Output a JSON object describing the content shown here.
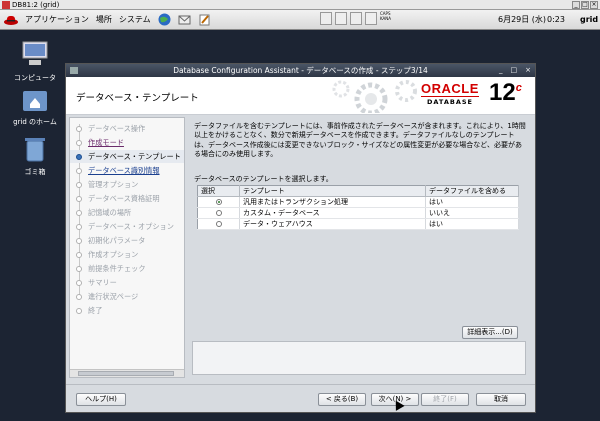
{
  "vnc": {
    "title": "DB81:2 (grid)"
  },
  "panel": {
    "menus": [
      "アプリケーション",
      "場所",
      "システム"
    ],
    "date": "6月29日 (水)",
    "time": "0:23",
    "user": "grid",
    "kbd_line1": "CAPS",
    "kbd_line2": "KANA"
  },
  "desktop": {
    "icons": [
      {
        "label": "コンピュータ"
      },
      {
        "label": "grid のホーム"
      },
      {
        "label": "ゴミ箱"
      }
    ]
  },
  "window": {
    "title": "Database Configuration Assistant - データベースの作成 - ステップ3/14",
    "controls": [
      "_",
      "□",
      "×"
    ]
  },
  "header": {
    "heading": "データベース・テンプレート",
    "oracle": "ORACLE",
    "database": "DATABASE",
    "version": "12",
    "version_sup": "c"
  },
  "nav": {
    "items": [
      {
        "label": "データベース操作",
        "state": "disabled"
      },
      {
        "label": "作成モード",
        "state": "done"
      },
      {
        "label": "データベース・テンプレート",
        "state": "current"
      },
      {
        "label": "データベース識別情報",
        "state": "link"
      },
      {
        "label": "管理オプション",
        "state": "disabled"
      },
      {
        "label": "データベース資格証明",
        "state": "disabled"
      },
      {
        "label": "記憶域の場所",
        "state": "disabled"
      },
      {
        "label": "データベース・オプション",
        "state": "disabled"
      },
      {
        "label": "初期化パラメータ",
        "state": "disabled"
      },
      {
        "label": "作成オプション",
        "state": "disabled"
      },
      {
        "label": "前提条件チェック",
        "state": "disabled"
      },
      {
        "label": "サマリー",
        "state": "disabled"
      },
      {
        "label": "進行状況ページ",
        "state": "disabled"
      },
      {
        "label": "終了",
        "state": "disabled"
      }
    ]
  },
  "content": {
    "description": "データファイルを含むテンプレートには、事前作成されたデータベースが含まれます。これにより、1時間以上をかけることなく、数分で新規データベースを作成できます。データファイルなしのテンプレートは、データベース作成後には変更できないブロック・サイズなどの属性変更が必要な場合など、必要がある場合にのみ使用します。",
    "prompt": "データベースのテンプレートを選択します。",
    "table": {
      "columns": [
        "選択",
        "テンプレート",
        "データファイルを含める"
      ],
      "rows": [
        {
          "selected": true,
          "template": "汎用またはトランザクション処理",
          "datafiles": "はい"
        },
        {
          "selected": false,
          "template": "カスタム・データベース",
          "datafiles": "いいえ"
        },
        {
          "selected": false,
          "template": "データ・ウェアハウス",
          "datafiles": "はい"
        }
      ]
    },
    "details_button": "詳細表示...(D)"
  },
  "footer": {
    "help": "ヘルプ(H)",
    "back": "< 戻る(B)",
    "next": "次へ(N) >",
    "finish": "終了(F)",
    "cancel": "取消"
  }
}
